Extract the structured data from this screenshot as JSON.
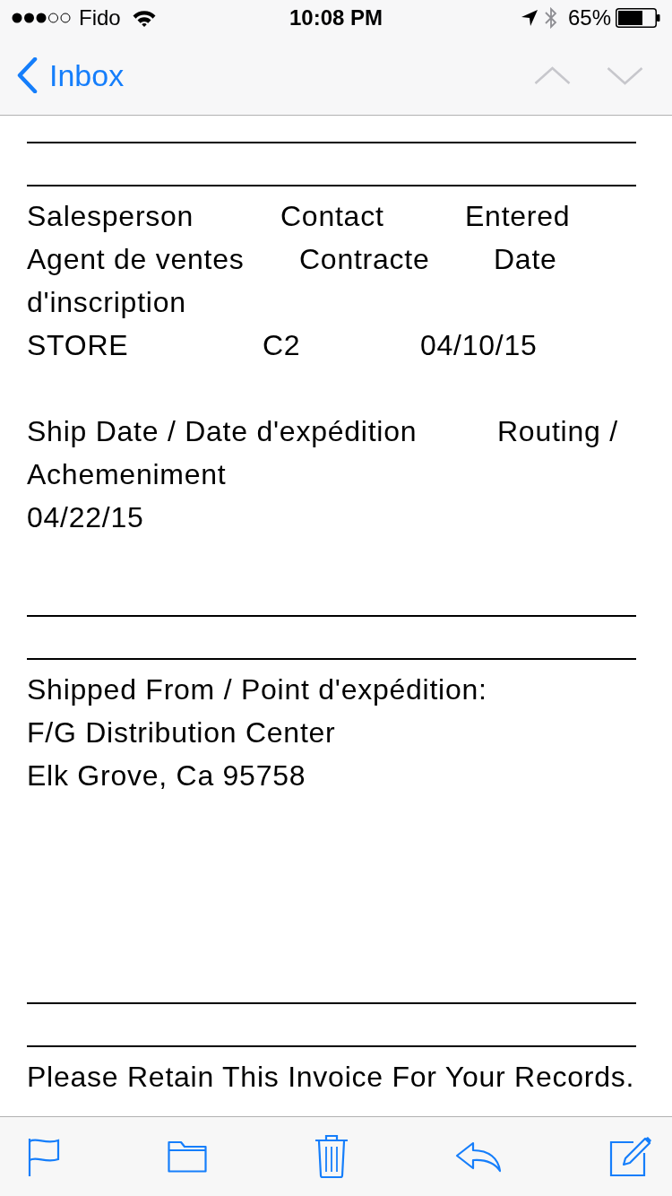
{
  "status_bar": {
    "carrier": "Fido",
    "time": "10:08 PM",
    "battery_percent": "65%"
  },
  "nav_bar": {
    "back_label": "Inbox",
    "message_arrows": [
      {
        "kind": "previous",
        "disabled": true
      },
      {
        "kind": "next",
        "disabled": true
      }
    ]
  },
  "email_body": {
    "order_info": {
      "lines": [
        [
          "Salesperson",
          "Contact",
          "Entered"
        ],
        [
          "Agent de ventes",
          "Contracte",
          "Date"
        ],
        [
          "d'inscription"
        ],
        [
          "STORE",
          "C2",
          "04/10/15"
        ]
      ]
    },
    "shipping": {
      "lines": [
        [
          "Ship Date / Date d'expédition",
          "Routing /"
        ],
        [
          "Achemeniment"
        ],
        [
          "04/22/15"
        ]
      ]
    },
    "shipped_from": {
      "lines": [
        "Shipped From / Point d'expédition:",
        "F/G Distribution Center",
        "Elk Grove, Ca 95758"
      ]
    },
    "notice": {
      "lines": [
        "Please Retain This Invoice For Your Records."
      ]
    }
  },
  "toolbar": [
    {
      "kind": "flag"
    },
    {
      "kind": "folder"
    },
    {
      "kind": "trash"
    },
    {
      "kind": "reply"
    },
    {
      "kind": "compose"
    }
  ]
}
